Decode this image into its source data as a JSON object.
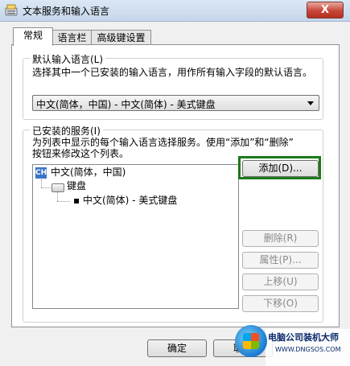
{
  "window": {
    "title": "文本服务和输入语言",
    "close_label": "X"
  },
  "tabs": [
    {
      "label": "常规",
      "active": true
    },
    {
      "label": "语言栏",
      "active": false
    },
    {
      "label": "高级键设置",
      "active": false
    }
  ],
  "default_language": {
    "legend": "默认输入语言(L)",
    "description": "选择其中一个已安装的输入语言，用作所有输入字段的默认语言。",
    "selected": "中文(简体，中国) - 中文(简体) - 美式键盘"
  },
  "installed_services": {
    "legend": "已安装的服务(I)",
    "description_line1": "为列表中显示的每个输入语言选择服务。使用“添加”和“删除”",
    "description_line2": "按钮来修改这个列表。",
    "tree": {
      "language_icon": "CH",
      "language": "中文(简体，中国)",
      "category": "键盘",
      "service": "中文(简体) - 美式键盘"
    },
    "buttons": {
      "add": "添加(D)...",
      "remove": "删除(R)",
      "properties": "属性(P)...",
      "move_up": "上移(U)",
      "move_down": "下移(O)"
    }
  },
  "footer": {
    "ok": "确定",
    "cancel": "取消"
  },
  "watermark": {
    "text": "电脑公司装机大师",
    "sub": "WWW.DNGSOS.COM"
  },
  "colors": {
    "highlight": "#1a7a1a",
    "selection": "#3a76c6"
  }
}
